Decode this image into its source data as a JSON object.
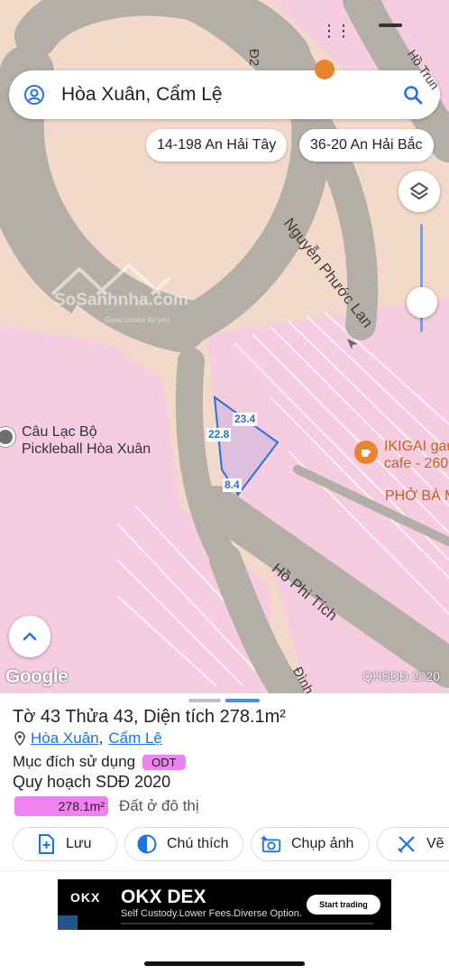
{
  "search": {
    "query": "Hòa Xuân, Cẩm Lệ"
  },
  "chips": [
    "14-198 An Hải Tây",
    "36-20 An Hải Bắc"
  ],
  "map": {
    "roads": {
      "nguyen_phuoc_lan": "Nguyễn Phước Lan",
      "ho_phi_tich": "Hồ Phi Tích",
      "ho_truong": "Hồ Trun",
      "dinh": "Đình",
      "d2": "Đ2"
    },
    "places": {
      "pickleball_line1": "Câu Lạc Bộ",
      "pickleball_line2": "Pickleball Hòa Xuân",
      "ikigai_line1": "IKIGAI gar",
      "ikigai_line2": "cafe - 260",
      "pho": "PHỞ BÀ M"
    },
    "parcel_edges": [
      "23.4",
      "22.8",
      "8.4"
    ],
    "watermark": {
      "name": "SoSanhnha.com",
      "tagline": "Great choice for you"
    },
    "attribution": "Google",
    "layer_label": "QHSDĐ 2020",
    "colors": {
      "residential_pink": "#f6cce0",
      "road_gray": "#b3aea6",
      "land_peach": "#f3d9c9",
      "parcel_blue": "#2f6fd8"
    }
  },
  "sheet": {
    "title": "Tờ 43 Thửa 43, Diện tích 278.1m²",
    "location_ward": "Hòa Xuân",
    "location_sep": ",",
    "location_district": "Cẩm Lệ",
    "purpose_label": "Mục đích sử dụng",
    "purpose_code": "ODT",
    "plan_label": "Quy hoạch SDĐ 2020",
    "area_value": "278.1m²",
    "area_desc": "Đất ở đô thị",
    "area_color": "#ee82ee"
  },
  "actions": {
    "save": "Lưu",
    "legend": "Chú thích",
    "capture": "Chụp ảnh",
    "draw": "Vẽ"
  },
  "ad": {
    "logo": "OKX",
    "headline": "OKX DEX",
    "subline": "Self Custody.Lower Fees.Diverse Option.",
    "cta": "Start trading"
  }
}
